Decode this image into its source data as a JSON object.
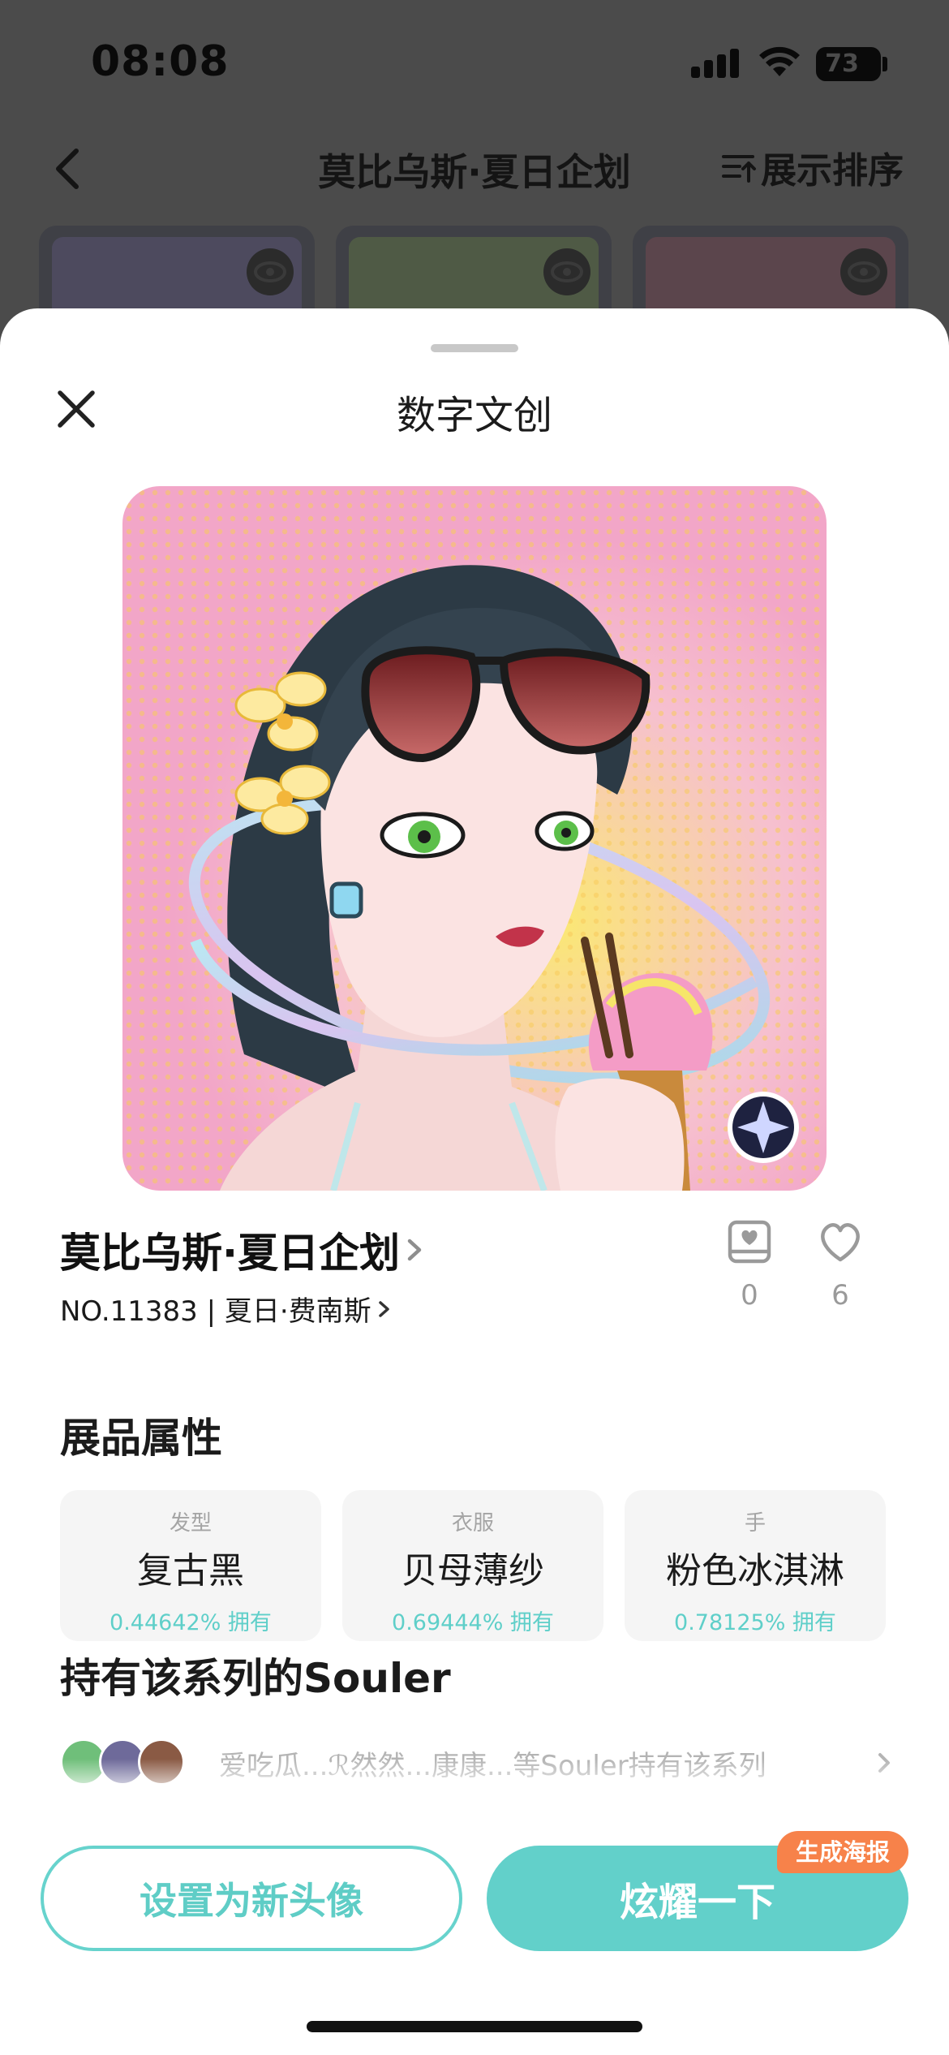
{
  "status_bar": {
    "time": "08:08",
    "battery": "73"
  },
  "nav": {
    "title": "莫比乌斯·夏日企划",
    "sort_label": "展示排序"
  },
  "sheet": {
    "title": "数字文创"
  },
  "nft": {
    "name": "莫比乌斯·夏日企划",
    "number_line": "NO.11383 | 夏日·费南斯",
    "collect_count": "0",
    "like_count": "6"
  },
  "attributes_section": {
    "title": "展品属性",
    "items": [
      {
        "type": "发型",
        "value": "复古黑",
        "rarity": "0.44642% 拥有"
      },
      {
        "type": "衣服",
        "value": "贝母薄纱",
        "rarity": "0.69444% 拥有"
      },
      {
        "type": "手",
        "value": "粉色冰淇淋",
        "rarity": "0.78125% 拥有"
      }
    ]
  },
  "owners_section": {
    "title": "持有该系列的Souler",
    "summary": "爱吃瓜...ℛ然然...康康...等Souler持有该系列"
  },
  "actions": {
    "set_avatar": "设置为新头像",
    "show_off": "炫耀一下",
    "poster_badge": "生成海报"
  },
  "colors": {
    "accent": "#62d0ca",
    "badge": "#f7824a",
    "artwork_bg": "#f2a6c8"
  }
}
